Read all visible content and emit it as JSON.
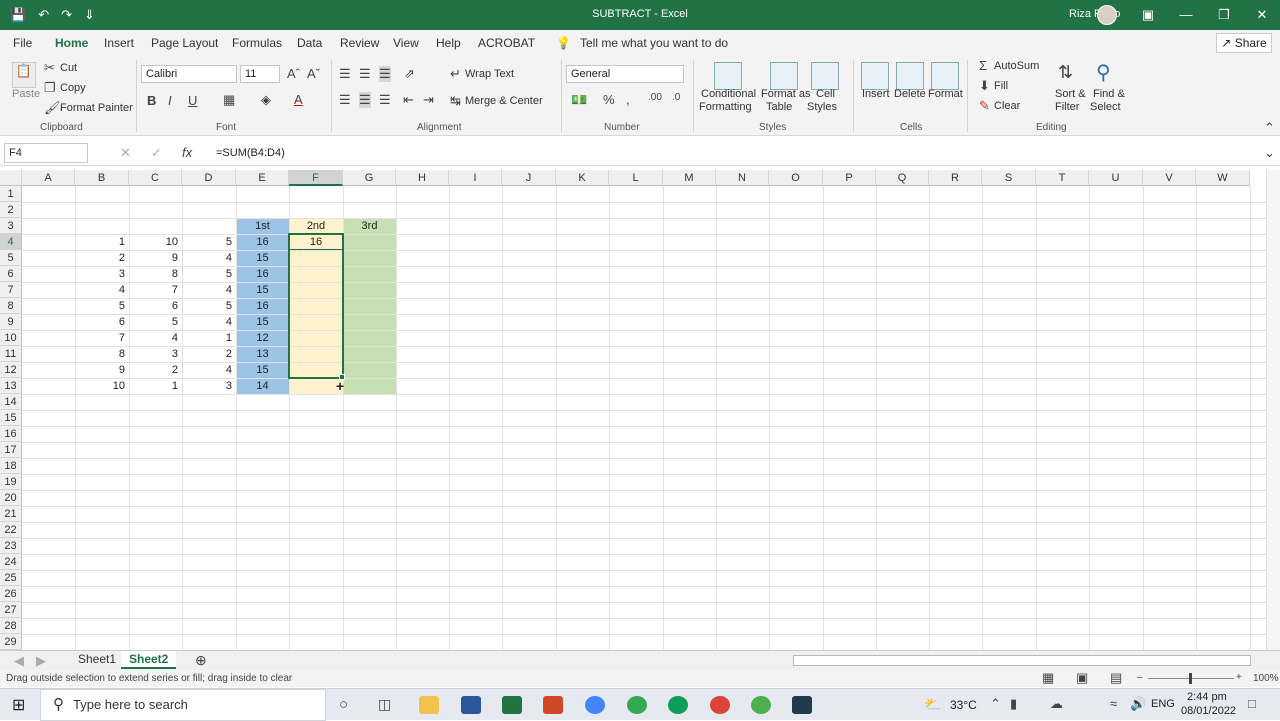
{
  "window": {
    "title": "SUBTRACT  -  Excel",
    "user": "Riza Forro"
  },
  "menu": {
    "tabs": [
      "File",
      "Home",
      "Insert",
      "Page Layout",
      "Formulas",
      "Data",
      "Review",
      "View",
      "Help",
      "ACROBAT"
    ],
    "active": "Home",
    "tell_me": "Tell me what you want to do",
    "share": "Share"
  },
  "ribbon": {
    "clipboard": {
      "label": "Clipboard",
      "paste": "Paste",
      "cut": "Cut",
      "copy": "Copy",
      "format_painter": "Format Painter"
    },
    "font": {
      "label": "Font",
      "name": "Calibri",
      "size": "11"
    },
    "alignment": {
      "label": "Alignment",
      "wrap_text": "Wrap Text",
      "merge_center": "Merge & Center"
    },
    "number": {
      "label": "Number",
      "format": "General"
    },
    "styles": {
      "label": "Styles",
      "conditional": "Conditional",
      "formatting": "Formatting",
      "format_as": "Format as",
      "table": "Table",
      "cell": "Cell",
      "styles_word": "Styles"
    },
    "cells": {
      "label": "Cells",
      "insert": "Insert",
      "delete": "Delete",
      "format": "Format"
    },
    "editing": {
      "label": "Editing",
      "autosum": "AutoSum",
      "fill": "Fill",
      "clear": "Clear",
      "sort": "Sort &",
      "filter": "Filter",
      "find": "Find &",
      "select": "Select"
    }
  },
  "formula_bar": {
    "name_box": "F4",
    "formula": "=SUM(B4:D4)"
  },
  "sheet": {
    "columns": [
      "A",
      "B",
      "C",
      "D",
      "E",
      "F",
      "G",
      "H",
      "I",
      "J",
      "K",
      "L",
      "M",
      "N",
      "O",
      "P",
      "Q",
      "R",
      "S",
      "T",
      "U",
      "V",
      "W"
    ],
    "rows": [
      "1",
      "2",
      "3",
      "4",
      "5",
      "6",
      "7",
      "8",
      "9",
      "10",
      "11",
      "12",
      "13",
      "14",
      "15",
      "16",
      "17",
      "18",
      "19",
      "20",
      "21",
      "22",
      "23",
      "24",
      "25",
      "26",
      "27",
      "28",
      "29"
    ],
    "headers": {
      "e3": "1st",
      "f3": "2nd",
      "g3": "3rd"
    },
    "col_b": [
      "1",
      "2",
      "3",
      "4",
      "5",
      "6",
      "7",
      "8",
      "9",
      "10"
    ],
    "col_c": [
      "10",
      "9",
      "8",
      "7",
      "6",
      "5",
      "4",
      "3",
      "2",
      "1"
    ],
    "col_d": [
      "5",
      "4",
      "5",
      "4",
      "5",
      "4",
      "1",
      "2",
      "4",
      "3"
    ],
    "col_e": [
      "16",
      "15",
      "16",
      "15",
      "16",
      "15",
      "12",
      "13",
      "15",
      "14"
    ],
    "f4": "16",
    "colors": {
      "blue": "#9dc3e6",
      "yellow": "#fff2cc",
      "green": "#c6e0b4",
      "accent": "#217346"
    }
  },
  "sheet_tabs": [
    "Sheet1",
    "Sheet2"
  ],
  "active_sheet": "Sheet2",
  "status": {
    "message": "Drag outside selection to extend series or fill; drag inside to clear",
    "zoom": "100%"
  },
  "taskbar": {
    "search": "Type here to search",
    "temp": "33°C",
    "lang": "ENG",
    "time": "2:44 pm",
    "date": "08/01/2022"
  }
}
